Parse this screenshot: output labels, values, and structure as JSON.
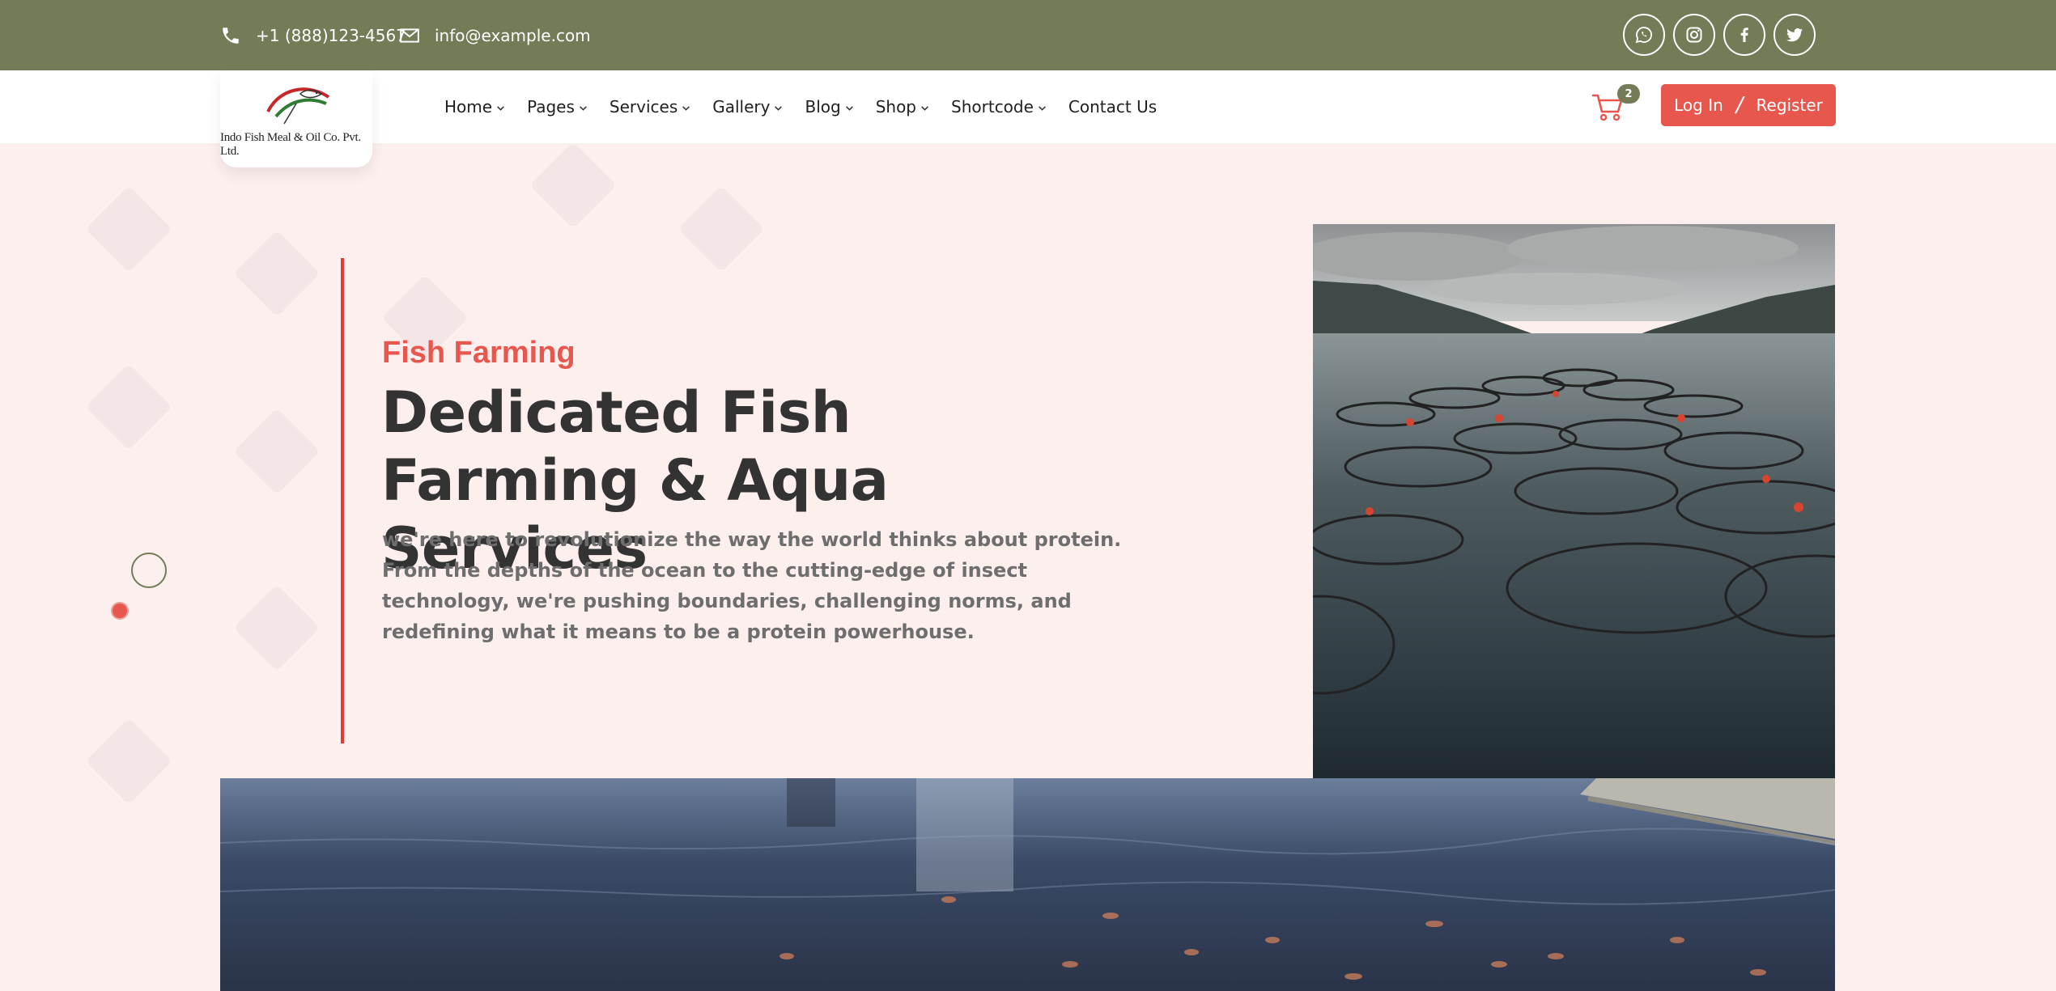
{
  "topbar": {
    "phone": "+1 (888)123-4567",
    "email": "info@example.com",
    "social": [
      "whatsapp-icon",
      "instagram-icon",
      "facebook-icon",
      "twitter-icon"
    ]
  },
  "logo": {
    "text": "Indo Fish Meal & Oil Co. Pvt. Ltd."
  },
  "nav": {
    "items": [
      {
        "label": "Home",
        "dropdown": true
      },
      {
        "label": "Pages",
        "dropdown": true
      },
      {
        "label": "Services",
        "dropdown": true
      },
      {
        "label": "Gallery",
        "dropdown": true
      },
      {
        "label": "Blog",
        "dropdown": true
      },
      {
        "label": "Shop",
        "dropdown": true
      },
      {
        "label": "Shortcode",
        "dropdown": true
      },
      {
        "label": "Contact Us",
        "dropdown": false
      }
    ],
    "cart_count": "2",
    "login_label": "Log In",
    "separator": "/",
    "register_label": "Register"
  },
  "hero": {
    "eyebrow": "Fish Farming",
    "title": "Dedicated Fish Farming & Aqua Services",
    "description": "we're here to revolutionize the way the world thinks about protein. From the depths of the ocean to the cutting-edge of insect technology, we're pushing boundaries, challenging norms, and redefining what it means to be a protein powerhouse."
  },
  "colors": {
    "olive": "#737c57",
    "accent_red": "#e8574d",
    "hero_bg": "#fcefee",
    "heading": "#333333"
  }
}
